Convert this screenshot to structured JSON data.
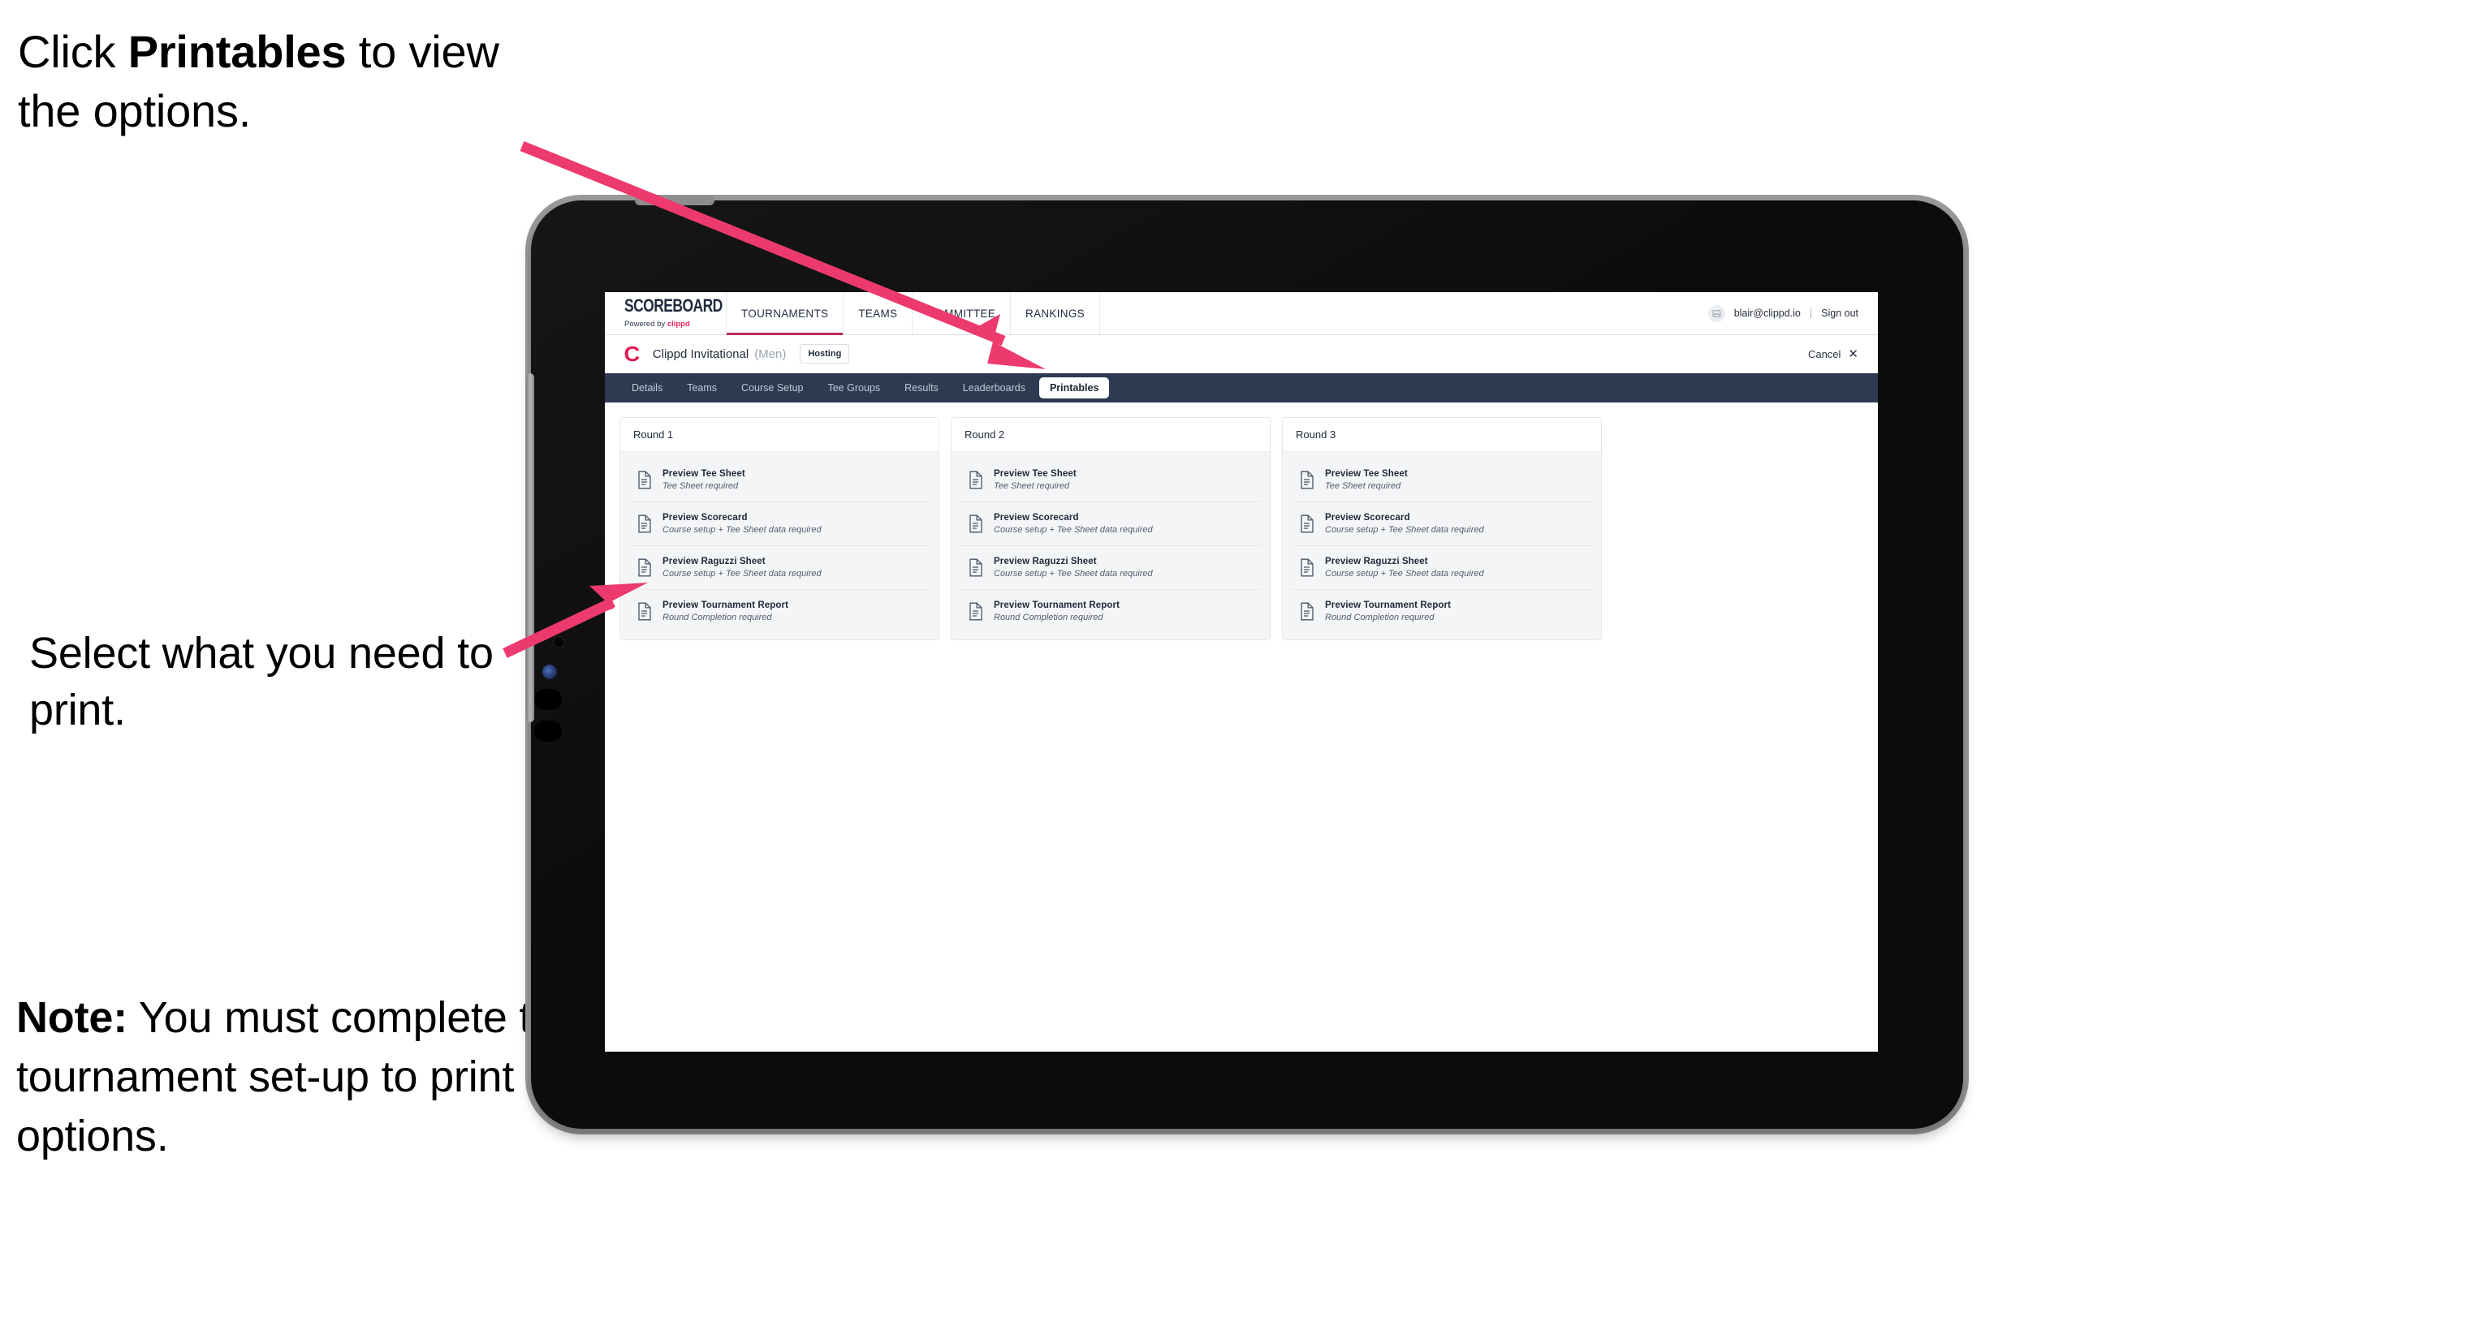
{
  "annotations": [
    {
      "id": "a1",
      "prefix": "Click ",
      "bold": "Printables",
      "suffix": " to view the options."
    },
    {
      "id": "a2",
      "text": "Select what you need to print."
    },
    {
      "id": "a3",
      "prefix": "",
      "bold": "Note:",
      "suffix": " You must complete the tournament set-up to print all the options."
    }
  ],
  "arrow_color": "#ED3A6E",
  "brand": {
    "logo_word": "SCOREBOARD",
    "logo_sub_prefix": "Powered by ",
    "logo_sub_brand": "clippd",
    "accent": "#e8275c",
    "subnav_bg": "#2d3a51"
  },
  "topnav": {
    "items": [
      {
        "label": "TOURNAMENTS",
        "active": true
      },
      {
        "label": "TEAMS",
        "active": false
      },
      {
        "label": "COMMITTEE",
        "active": false
      },
      {
        "label": "RANKINGS",
        "active": false
      }
    ],
    "account": {
      "avatar_icon": "user-avatar-icon",
      "email": "blair@clippd.io",
      "separator": "|",
      "sign_out": "Sign out"
    }
  },
  "titlebar": {
    "logo_letter": "C",
    "tournament_name": "Clippd Invitational",
    "gender": "(Men)",
    "status_badge": "Hosting",
    "cancel_label": "Cancel",
    "cancel_icon": "close-icon"
  },
  "subnav": {
    "items": [
      {
        "label": "Details",
        "active": false
      },
      {
        "label": "Teams",
        "active": false
      },
      {
        "label": "Course Setup",
        "active": false
      },
      {
        "label": "Tee Groups",
        "active": false
      },
      {
        "label": "Results",
        "active": false
      },
      {
        "label": "Leaderboards",
        "active": false
      },
      {
        "label": "Printables",
        "active": true
      }
    ]
  },
  "printables": {
    "rounds": [
      {
        "header": "Round 1",
        "items": [
          {
            "title": "Preview Tee Sheet",
            "sub": "Tee Sheet required"
          },
          {
            "title": "Preview Scorecard",
            "sub": "Course setup + Tee Sheet data required"
          },
          {
            "title": "Preview Raguzzi Sheet",
            "sub": "Course setup + Tee Sheet data required"
          },
          {
            "title": "Preview Tournament Report",
            "sub": "Round Completion required"
          }
        ]
      },
      {
        "header": "Round 2",
        "items": [
          {
            "title": "Preview Tee Sheet",
            "sub": "Tee Sheet required"
          },
          {
            "title": "Preview Scorecard",
            "sub": "Course setup + Tee Sheet data required"
          },
          {
            "title": "Preview Raguzzi Sheet",
            "sub": "Course setup + Tee Sheet data required"
          },
          {
            "title": "Preview Tournament Report",
            "sub": "Round Completion required"
          }
        ]
      },
      {
        "header": "Round 3",
        "items": [
          {
            "title": "Preview Tee Sheet",
            "sub": "Tee Sheet required"
          },
          {
            "title": "Preview Scorecard",
            "sub": "Course setup + Tee Sheet data required"
          },
          {
            "title": "Preview Raguzzi Sheet",
            "sub": "Course setup + Tee Sheet data required"
          },
          {
            "title": "Preview Tournament Report",
            "sub": "Round Completion required"
          }
        ]
      }
    ]
  }
}
